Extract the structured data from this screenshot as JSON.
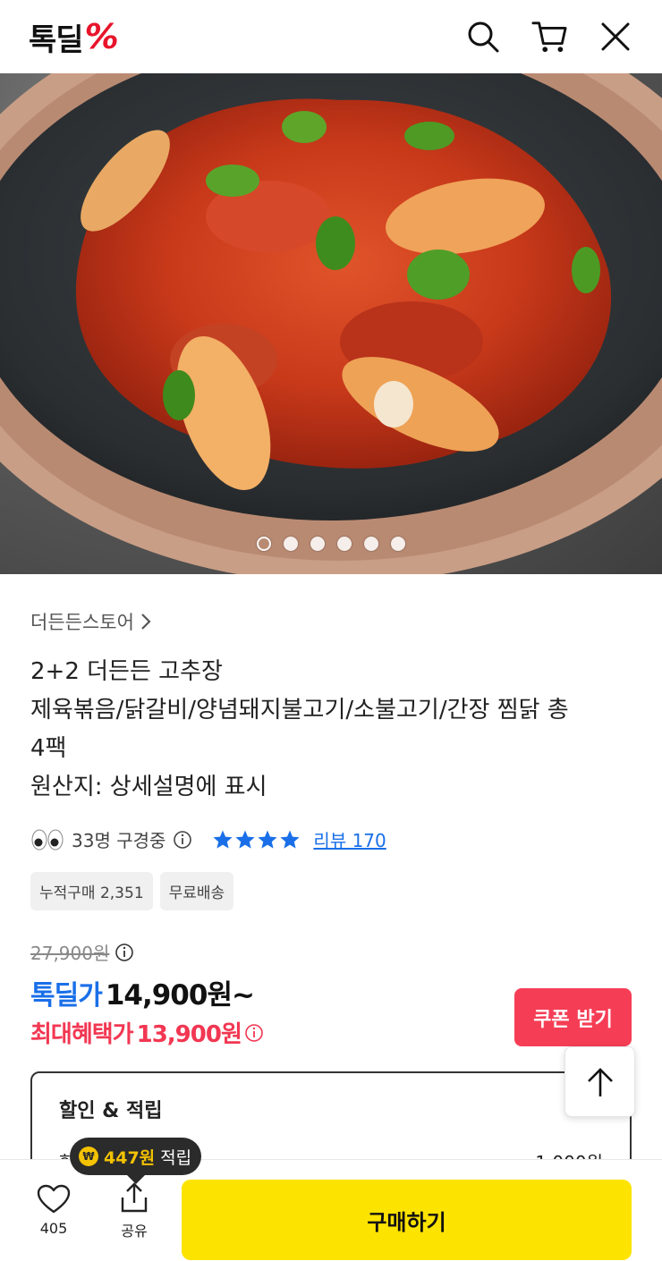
{
  "header": {
    "logo_text": "톡딜",
    "logo_symbol": "%",
    "icons": [
      "search-icon",
      "cart-icon",
      "close-icon"
    ]
  },
  "hero": {
    "slide_count": 6,
    "active_slide": 1
  },
  "product": {
    "store_name": "더든든스토어",
    "title_lines": [
      "2+2 더든든 고추장",
      "제육볶음/닭갈비/양념돼지불고기/소불고기/간장 찜닭 총",
      "4팩",
      "원산지: 상세설명에 표시"
    ],
    "viewers": "33명 구경중",
    "rating_stars": 4,
    "review_label": "리뷰 170",
    "tags": [
      "누적구매 2,351",
      "무료배송"
    ],
    "original_price": "27,900원",
    "deal_label": "톡딜가",
    "deal_price": "14,900원~",
    "max_label": "최대혜택가",
    "max_price": "13,900원"
  },
  "buttons": {
    "coupon": "쿠폰 받기",
    "buy": "구매하기"
  },
  "benefit": {
    "title": "할인 & 적립",
    "row_label": "할",
    "row_value": "-1,000원"
  },
  "bottom_bar": {
    "like_count": "405",
    "share_label": "공유"
  },
  "tooltip": {
    "coin_symbol": "₩",
    "amount": "447원",
    "label": "적립"
  },
  "colors": {
    "brand_red": "#e8142b",
    "deal_blue": "#1a6fe8",
    "benefit_red": "#f23752",
    "coupon_bg": "#f53e55",
    "buy_yellow": "#fde300"
  }
}
